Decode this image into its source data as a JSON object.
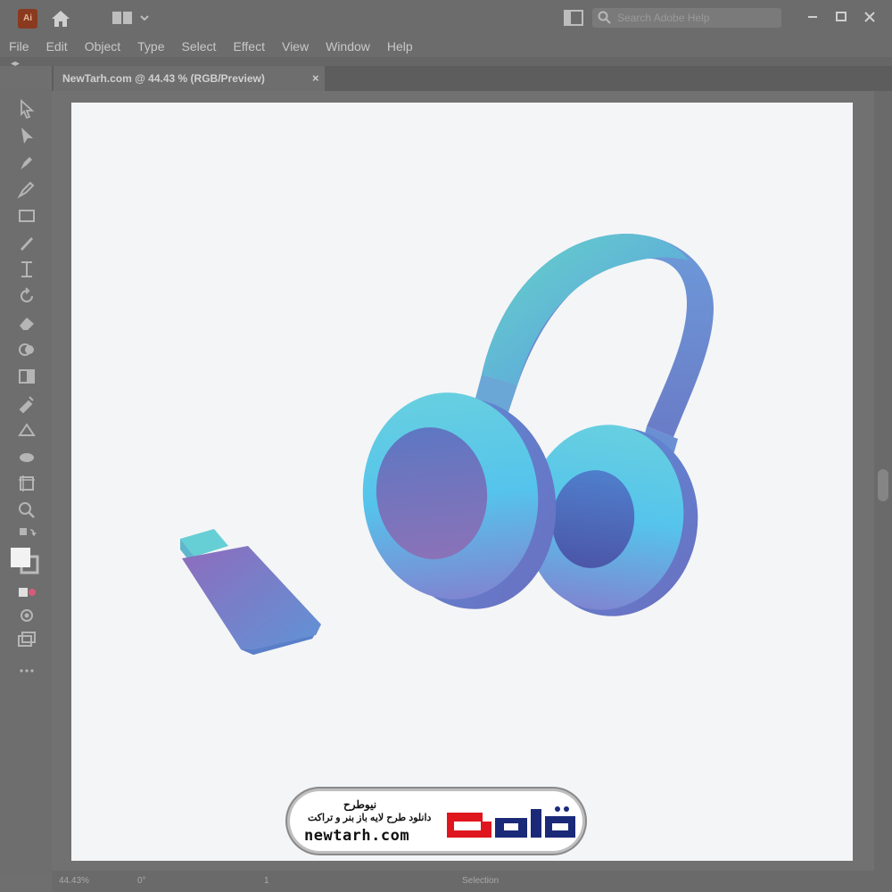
{
  "app": {
    "logo_text": "Ai",
    "search_placeholder": "Search Adobe Help"
  },
  "menu": [
    "File",
    "Edit",
    "Object",
    "Type",
    "Select",
    "Effect",
    "View",
    "Window",
    "Help"
  ],
  "document_tab": {
    "title": "NewTarh.com @ 44.43 % (RGB/Preview)",
    "close": "×"
  },
  "statusbar": {
    "zoom": "44.43%",
    "rotation": "0°",
    "artboard": "1",
    "mode": "Selection"
  },
  "tools": [
    "selection-tool",
    "direct-selection-tool",
    "pen-tool",
    "curvature-tool",
    "rectangle-tool",
    "paintbrush-tool",
    "width-tool",
    "rotate-tool",
    "eraser-tool",
    "shape-builder-tool",
    "gradient-tool",
    "eyedropper-tool",
    "blend-tool",
    "symbol-sprayer-tool",
    "artboard-tool",
    "zoom-tool",
    "swap-colors",
    "fill-stroke",
    "draw-modes",
    "screen-mode",
    "edit-toolbar"
  ],
  "watermark": {
    "brand_fa": "نیوطرح",
    "tagline_fa": "دانلود طرح لایه باز بنر و تراکت",
    "url": "newtarh.com",
    "logo_text_fa": "نیوطرح"
  },
  "colors": {
    "chrome": "#6c6c6c",
    "artboard": "#f4f5f7",
    "accent_teal": "#5fd0d6",
    "accent_blue": "#5b8fd8",
    "accent_purple": "#8a6fbd",
    "logo_red": "#e0161e",
    "logo_navy": "#1a2a78"
  }
}
